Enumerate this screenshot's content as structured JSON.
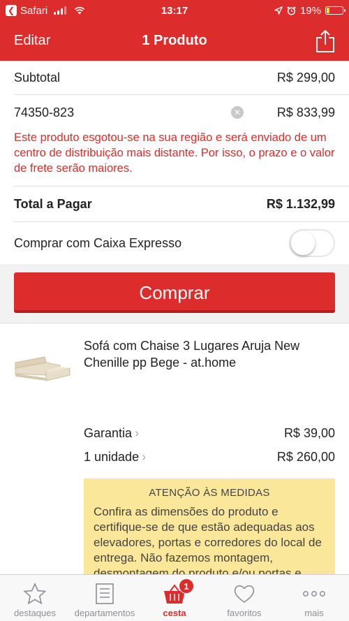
{
  "status_bar": {
    "carrier": "Safari",
    "time": "13:17",
    "battery_pct": "19%",
    "battery_level": 0.19
  },
  "nav": {
    "edit_label": "Editar",
    "title": "1 Produto"
  },
  "summary": {
    "subtotal_label": "Subtotal",
    "subtotal_value": "R$ 299,00",
    "cep": "74350-823",
    "freight_value": "R$ 833,99",
    "warning": "Este produto esgotou-se na sua região e será enviado de um centro de distribuição mais distante. Por isso, o prazo e o valor de frete serão maiores.",
    "total_label": "Total a Pagar",
    "total_value": "R$ 1.132,99",
    "express_label": "Comprar com Caixa Expresso",
    "express_enabled": false
  },
  "buy_button_label": "Comprar",
  "product": {
    "name": "Sofá com Chaise 3 Lugares Aruja New Chenille pp Bege - at.home",
    "warranty_label": "Garantia",
    "warranty_value": "R$ 39,00",
    "quantity_label": "1 unidade",
    "quantity_value": "R$ 260,00"
  },
  "notice": {
    "title": "ATENÇÃO ÀS MEDIDAS",
    "body": "Confira as dimensões do produto e certifique-se de que estão adequadas aos elevadores, portas e corredores do local de entrega. Não fazemos montagem, desmontagem do produto e/ou portas e janelas, transporte pela escada ou içamento do produto."
  },
  "tabbar": {
    "items": [
      {
        "label": "destaques",
        "icon": "star-icon"
      },
      {
        "label": "departamentos",
        "icon": "list-icon"
      },
      {
        "label": "cesta",
        "icon": "basket-icon",
        "badge": "1"
      },
      {
        "label": "favoritos",
        "icon": "heart-icon"
      },
      {
        "label": "mais",
        "icon": "more-icon"
      }
    ]
  },
  "colors": {
    "brand_red": "#dd2c2c",
    "notice_yellow": "#fae79a"
  }
}
